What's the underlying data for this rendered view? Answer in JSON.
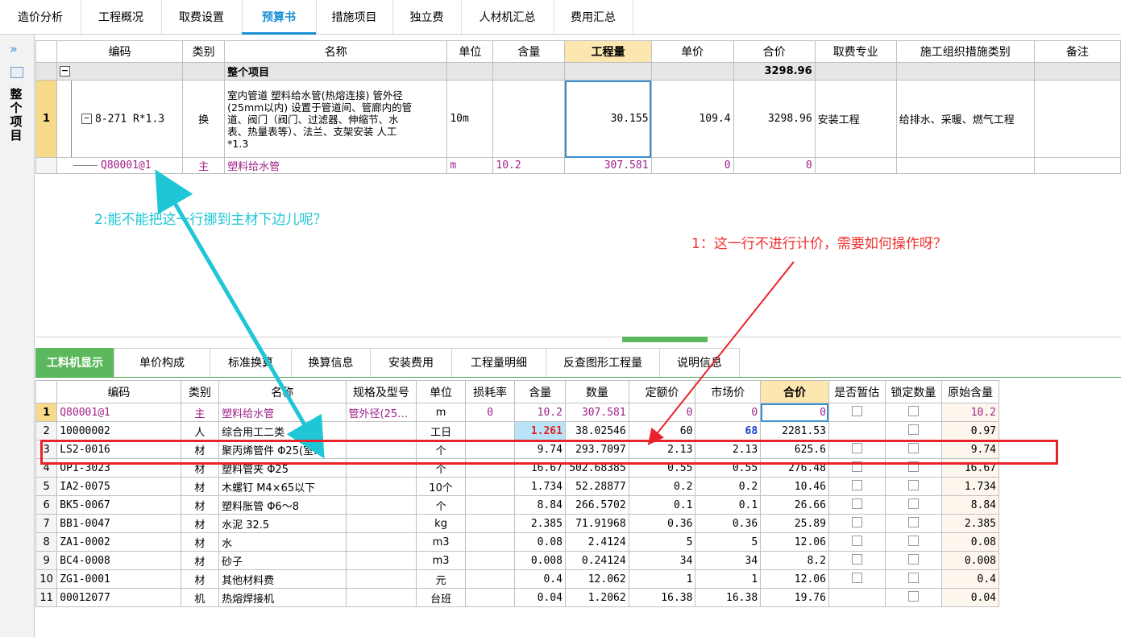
{
  "top_tabs": [
    "造价分析",
    "工程概况",
    "取费设置",
    "预算书",
    "措施项目",
    "独立费",
    "人材机汇总",
    "费用汇总"
  ],
  "left_strip": {
    "collapse_glyph": "»",
    "label": "整个项目"
  },
  "upper_table": {
    "headers": [
      "编码",
      "类别",
      "名称",
      "单位",
      "含量",
      "工程量",
      "单价",
      "合价",
      "取费专业",
      "施工组织措施类别",
      "备注"
    ],
    "whole_row": {
      "name": "整个项目",
      "total": "3298.96"
    },
    "row1": {
      "num": "1",
      "code": "8-271 R*1.3",
      "type": "换",
      "name_lines": [
        "室内管道 塑料给水管(热熔连接) 管外径",
        "(25mm以内) 设置于管道间、管廊内的管",
        "道、阀门（阀门、过滤器、伸缩节、水",
        "表、热量表等）、法兰、支架安装 人工",
        "*1.3"
      ],
      "unit": "10m",
      "qty": "30.155",
      "price": "109.4",
      "total": "3298.96",
      "fee": "安装工程",
      "org": "给排水、采暖、燃气工程"
    },
    "row2": {
      "code": "Q80001@1",
      "type": "主",
      "name": "塑料给水管",
      "unit": "m",
      "content": "10.2",
      "qty": "307.581",
      "price": "0",
      "total": "0"
    }
  },
  "bottom_tabs": [
    "工料机显示",
    "单价构成",
    "标准换算",
    "换算信息",
    "安装费用",
    "工程量明细",
    "反查图形工程量",
    "说明信息"
  ],
  "lower_table": {
    "headers": [
      "编码",
      "类别",
      "名称",
      "规格及型号",
      "单位",
      "损耗率",
      "含量",
      "数量",
      "定额价",
      "市场价",
      "合价",
      "是否暂估",
      "锁定数量",
      "原始含量"
    ],
    "rows": [
      {
        "n": "1",
        "code": "Q80001@1",
        "type": "主",
        "name": "塑料给水管",
        "spec": "管外径(25…",
        "unit": "m",
        "loss": "0",
        "content": "10.2",
        "qty": "307.581",
        "quota": "0",
        "market": "0",
        "total": "0",
        "est": false,
        "lock": false,
        "orig": "10.2"
      },
      {
        "n": "2",
        "code": "10000002",
        "type": "人",
        "name": "综合用工二类",
        "spec": "",
        "unit": "工日",
        "loss": "",
        "content": "1.261",
        "qty": "38.02546",
        "quota": "60",
        "market": "68",
        "total": "2281.53",
        "est": null,
        "lock": false,
        "orig": "0.97"
      },
      {
        "n": "3",
        "code": "LS2-0016",
        "type": "材",
        "name": "聚丙烯管件 Φ25(室…",
        "spec": "",
        "unit": "个",
        "loss": "",
        "content": "9.74",
        "qty": "293.7097",
        "quota": "2.13",
        "market": "2.13",
        "total": "625.6",
        "est": false,
        "lock": false,
        "orig": "9.74"
      },
      {
        "n": "4",
        "code": "OP1-3023",
        "type": "材",
        "name": "塑料管夹 Φ25",
        "spec": "",
        "unit": "个",
        "loss": "",
        "content": "16.67",
        "qty": "502.68385",
        "quota": "0.55",
        "market": "0.55",
        "total": "276.48",
        "est": false,
        "lock": false,
        "orig": "16.67"
      },
      {
        "n": "5",
        "code": "IA2-0075",
        "type": "材",
        "name": "木螺钉 M4×65以下",
        "spec": "",
        "unit": "10个",
        "loss": "",
        "content": "1.734",
        "qty": "52.28877",
        "quota": "0.2",
        "market": "0.2",
        "total": "10.46",
        "est": false,
        "lock": false,
        "orig": "1.734"
      },
      {
        "n": "6",
        "code": "BK5-0067",
        "type": "材",
        "name": "塑料胀管 Φ6～8",
        "spec": "",
        "unit": "个",
        "loss": "",
        "content": "8.84",
        "qty": "266.5702",
        "quota": "0.1",
        "market": "0.1",
        "total": "26.66",
        "est": false,
        "lock": false,
        "orig": "8.84"
      },
      {
        "n": "7",
        "code": "BB1-0047",
        "type": "材",
        "name": "水泥 32.5",
        "spec": "",
        "unit": "kg",
        "loss": "",
        "content": "2.385",
        "qty": "71.91968",
        "quota": "0.36",
        "market": "0.36",
        "total": "25.89",
        "est": false,
        "lock": false,
        "orig": "2.385"
      },
      {
        "n": "8",
        "code": "ZA1-0002",
        "type": "材",
        "name": "水",
        "spec": "",
        "unit": "m3",
        "loss": "",
        "content": "0.08",
        "qty": "2.4124",
        "quota": "5",
        "market": "5",
        "total": "12.06",
        "est": false,
        "lock": false,
        "orig": "0.08"
      },
      {
        "n": "9",
        "code": "BC4-0008",
        "type": "材",
        "name": "砂子",
        "spec": "",
        "unit": "m3",
        "loss": "",
        "content": "0.008",
        "qty": "0.24124",
        "quota": "34",
        "market": "34",
        "total": "8.2",
        "est": false,
        "lock": false,
        "orig": "0.008"
      },
      {
        "n": "10",
        "code": "ZG1-0001",
        "type": "材",
        "name": "其他材料费",
        "spec": "",
        "unit": "元",
        "loss": "",
        "content": "0.4",
        "qty": "12.062",
        "quota": "1",
        "market": "1",
        "total": "12.06",
        "est": false,
        "lock": false,
        "orig": "0.4"
      },
      {
        "n": "11",
        "code": "00012077",
        "type": "机",
        "name": "热熔焊接机",
        "spec": "",
        "unit": "台班",
        "loss": "",
        "content": "0.04",
        "qty": "1.2062",
        "quota": "16.38",
        "market": "16.38",
        "total": "19.76",
        "est": null,
        "lock": false,
        "orig": "0.04"
      }
    ]
  },
  "annotations": {
    "note1": "1：这一行不进行计价，需要如何操作呀？",
    "note2": "2:能不能把这一行挪到主材下边儿呢？",
    "note1_color": "#e8232a",
    "note2_color": "#1fc6d6"
  },
  "colors": {
    "accent_blue": "#1a8fd6",
    "tab_green": "#5cb85c",
    "highlight_header": "#fde7b0",
    "main_material_purple": "#a0208a"
  }
}
